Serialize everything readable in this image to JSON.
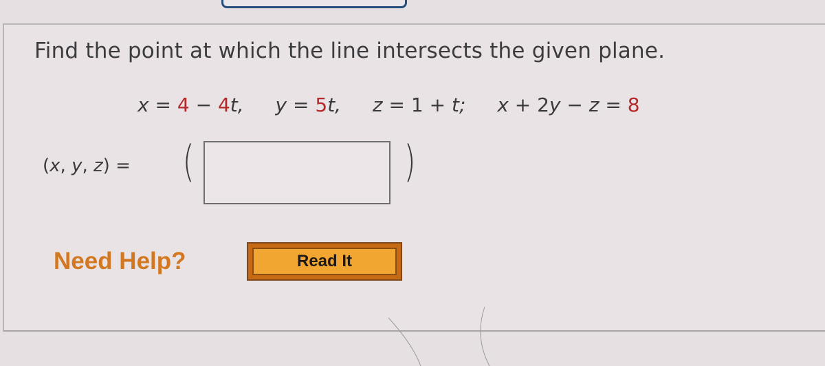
{
  "question": {
    "prompt": "Find the point at which the line intersects the given plane.",
    "equations": {
      "x_lhs": "x",
      "eq": "=",
      "x_const": "4",
      "minus": "−",
      "x_coef": "4",
      "t": "t",
      "comma": ",",
      "y_lhs": "y",
      "y_coef": "5",
      "z_lhs": "z",
      "z_const": "1",
      "plus": "+",
      "semicolon": ";",
      "plane_lhs_x": "x",
      "plane_two": "2",
      "plane_y": "y",
      "plane_z": "z",
      "plane_rhs": "8"
    },
    "answer_label": "(x, y, z)",
    "answer_label_parts": {
      "open": "(",
      "x": "x",
      "sep": ", ",
      "y": "y",
      "z": "z",
      "close": ")",
      "eq": " ="
    },
    "answer_value": "",
    "paren_open": "(",
    "paren_close": ")"
  },
  "help": {
    "label": "Need Help?",
    "read_it_button": "Read It"
  },
  "colors": {
    "highlight_red": "#b42a2a",
    "help_orange": "#d27822",
    "button_orange": "#f0a630",
    "tab_border_blue": "#264f7c"
  }
}
